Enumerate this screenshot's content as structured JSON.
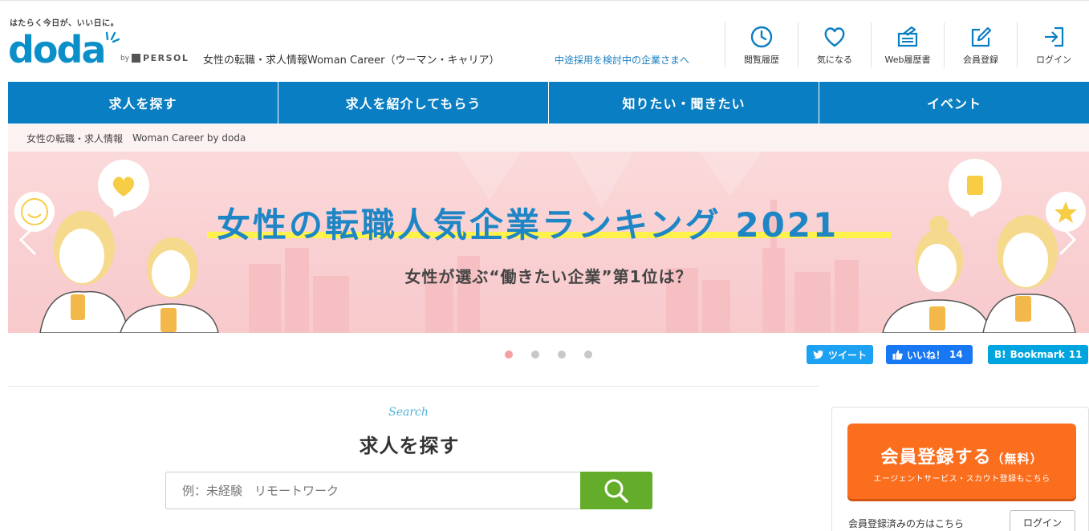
{
  "header": {
    "tagline": "はたらく今日が、いい日に。",
    "logo_text": "doda",
    "logo_by": "by",
    "logo_company": "PERSOL",
    "site_title": "女性の転職・求人情報Woman Career（ウーマン・キャリア）",
    "corporate_link": "中途採用を検討中の企業さまへ",
    "nav": [
      {
        "label": "閲覧履歴",
        "icon": "clock-icon"
      },
      {
        "label": "気になる",
        "icon": "heart-icon"
      },
      {
        "label": "Web履歴書",
        "icon": "resume-icon"
      },
      {
        "label": "会員登録",
        "icon": "edit-icon"
      },
      {
        "label": "ログイン",
        "icon": "login-icon"
      }
    ]
  },
  "main_nav": [
    {
      "label": "求人を探す"
    },
    {
      "label": "求人を紹介してもらう"
    },
    {
      "label": "知りたい・聞きたい"
    },
    {
      "label": "イベント"
    }
  ],
  "breadcrumb": {
    "label": "女性の転職・求人情報",
    "brand": "Woman Career by doda"
  },
  "banner": {
    "title": "女性の転職人気企業ランキング 2021",
    "subtitle": "女性が選ぶ“働きたい企業”第1位は？",
    "slides": 4,
    "active_slide": 1
  },
  "social": {
    "tweet_label": "ツイート",
    "like_label": "いいね！",
    "like_count": "14",
    "bookmark_label": "Bookmark",
    "bookmark_count": "11"
  },
  "search": {
    "script_label": "Search",
    "title": "求人を探す",
    "placeholder": "例：未経験　リモートワーク",
    "value": ""
  },
  "register": {
    "main_label": "会員登録する",
    "free_label": "（無料）",
    "sub_label": "エージェントサービス・スカウト登録もこちら",
    "member_text": "会員登録済みの方はこちら",
    "login_label": "ログイン"
  },
  "colors": {
    "brand_blue": "#0a7ec2",
    "logo_blue": "#0a8fc9",
    "banner_pink": "#f9cfd1",
    "banner_title": "#1f86c6",
    "highlight_yellow": "#fff24a",
    "search_green": "#64ad2b",
    "register_orange": "#fb6e1e"
  }
}
